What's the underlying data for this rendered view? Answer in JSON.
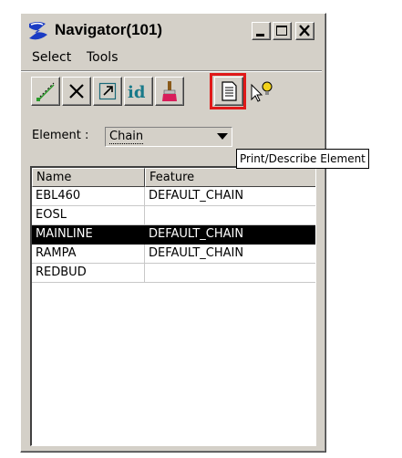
{
  "window": {
    "title": "Navigator(101)"
  },
  "menu": [
    {
      "label": "Select"
    },
    {
      "label": "Tools"
    }
  ],
  "toolbar": {
    "buttons": [
      {
        "icon": "draw-line-icon"
      },
      {
        "icon": "delete-x-icon"
      },
      {
        "icon": "window-arrow-icon"
      },
      {
        "icon": "id-icon"
      },
      {
        "icon": "paint-brush-icon"
      },
      {
        "icon": "print-describe-icon"
      },
      {
        "icon": "pointer-bulb-icon"
      }
    ],
    "highlighted": "print-describe-icon"
  },
  "element": {
    "label": "Element :",
    "value": "Chain"
  },
  "tooltip": "Print/Describe Element",
  "table": {
    "columns": [
      "Name",
      "Feature"
    ],
    "rows": [
      {
        "name": "EBL460",
        "feature": "DEFAULT_CHAIN"
      },
      {
        "name": "EOSL",
        "feature": ""
      },
      {
        "name": "MAINLINE",
        "feature": "DEFAULT_CHAIN"
      },
      {
        "name": "RAMPA",
        "feature": "DEFAULT_CHAIN"
      },
      {
        "name": "REDBUD",
        "feature": ""
      }
    ],
    "selected_row": 2
  },
  "colors": {
    "highlight": "#e01919",
    "selection": "#000000",
    "face": "#d4d0c8"
  }
}
